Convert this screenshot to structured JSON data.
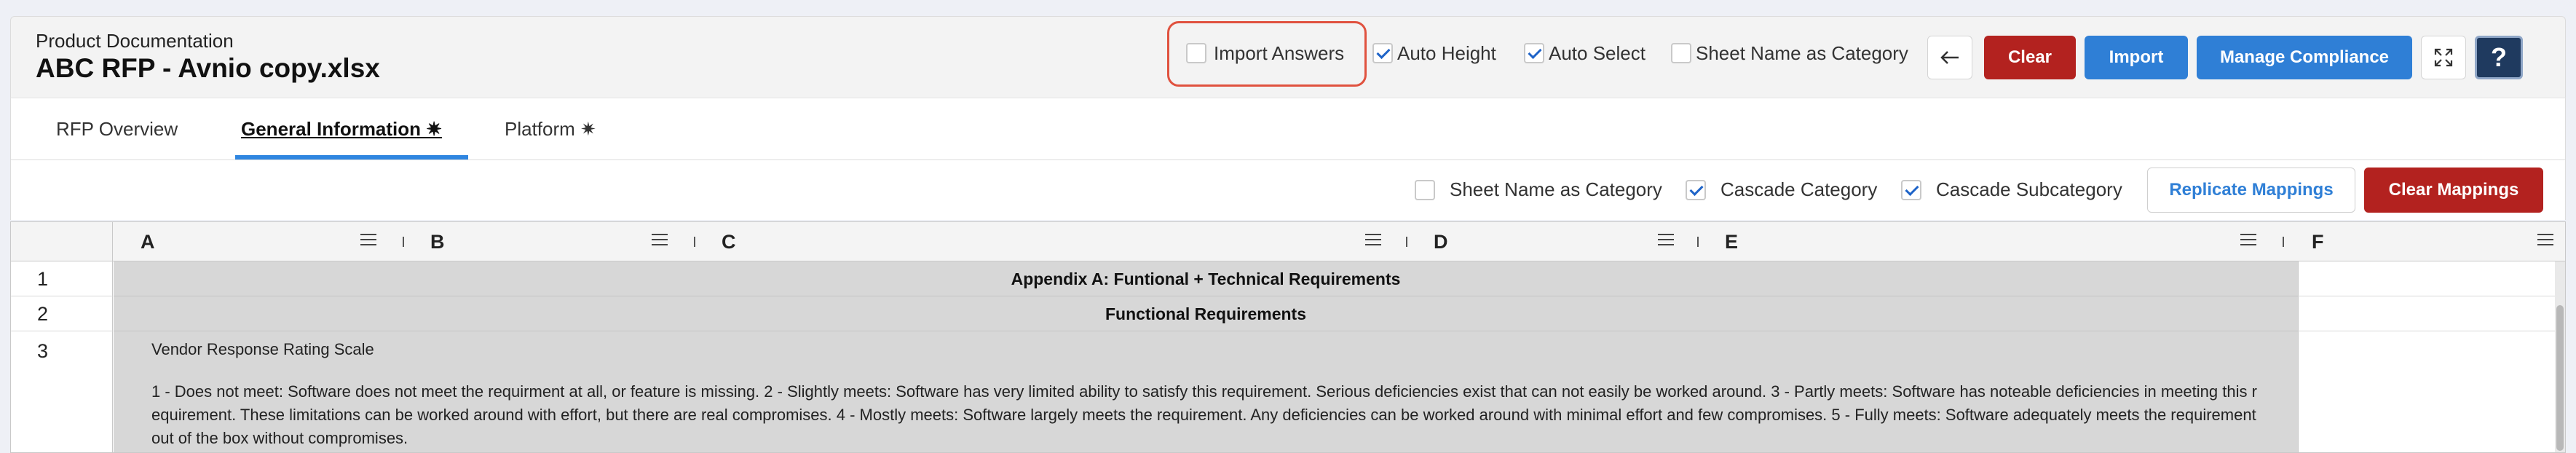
{
  "header": {
    "subtitle": "Product Documentation",
    "title": "ABC RFP - Avnio copy.xlsx",
    "options": {
      "import_answers": {
        "label": "Import Answers",
        "checked": false
      },
      "auto_height": {
        "label": "Auto Height",
        "checked": true
      },
      "auto_select": {
        "label": "Auto Select",
        "checked": true
      },
      "sheet_name_as_category": {
        "label": "Sheet Name as Category",
        "checked": false
      }
    },
    "buttons": {
      "clear": "Clear",
      "import": "Import",
      "manage_compliance": "Manage Compliance",
      "help": "?"
    },
    "icons": {
      "back": "arrow-left-icon",
      "expand": "expand-icon"
    }
  },
  "tabs": [
    {
      "label": "RFP Overview",
      "active": false
    },
    {
      "label": "General Information ✷",
      "active": true
    },
    {
      "label": "Platform ✷",
      "active": false
    }
  ],
  "mapping_toolbar": {
    "sheet_name_as_category": {
      "label": "Sheet Name as Category",
      "checked": false
    },
    "cascade_category": {
      "label": "Cascade Category",
      "checked": true
    },
    "cascade_subcategory": {
      "label": "Cascade Subcategory",
      "checked": true
    },
    "replicate_mappings": "Replicate Mappings",
    "clear_mappings": "Clear Mappings"
  },
  "grid": {
    "columns": [
      "A",
      "B",
      "C",
      "D",
      "E",
      "F"
    ],
    "rows": [
      {
        "num": "1",
        "text": "Appendix A: Funtional + Technical Requirements"
      },
      {
        "num": "2",
        "text": "Functional Requirements"
      },
      {
        "num": "3",
        "lines": [
          "Vendor Response Rating Scale",
          "",
          "1 - Does not meet: Software does not meet the requirment at all, or feature is missing. 2 - Slightly meets: Software has very limited ability to satisfy this requirement. Serious deficiencies exist that can not easily be worked around. 3 - Partly meets: Software has noteable deficiencies in meeting this r",
          "equirement. These limitations can be worked around with effort, but there are real compromises. 4 - Mostly meets: Software largely meets the requirement. Any deficiencies can be worked around with minimal effort and few compromises. 5 - Fully meets: Software adequately meets the requirement",
          "out of the box without compromises."
        ]
      }
    ]
  },
  "colors": {
    "accent_blue": "#2f7fd6",
    "danger_red": "#b3221f",
    "highlight_box": "#e0523f",
    "help_navy": "#1f3a5f"
  }
}
